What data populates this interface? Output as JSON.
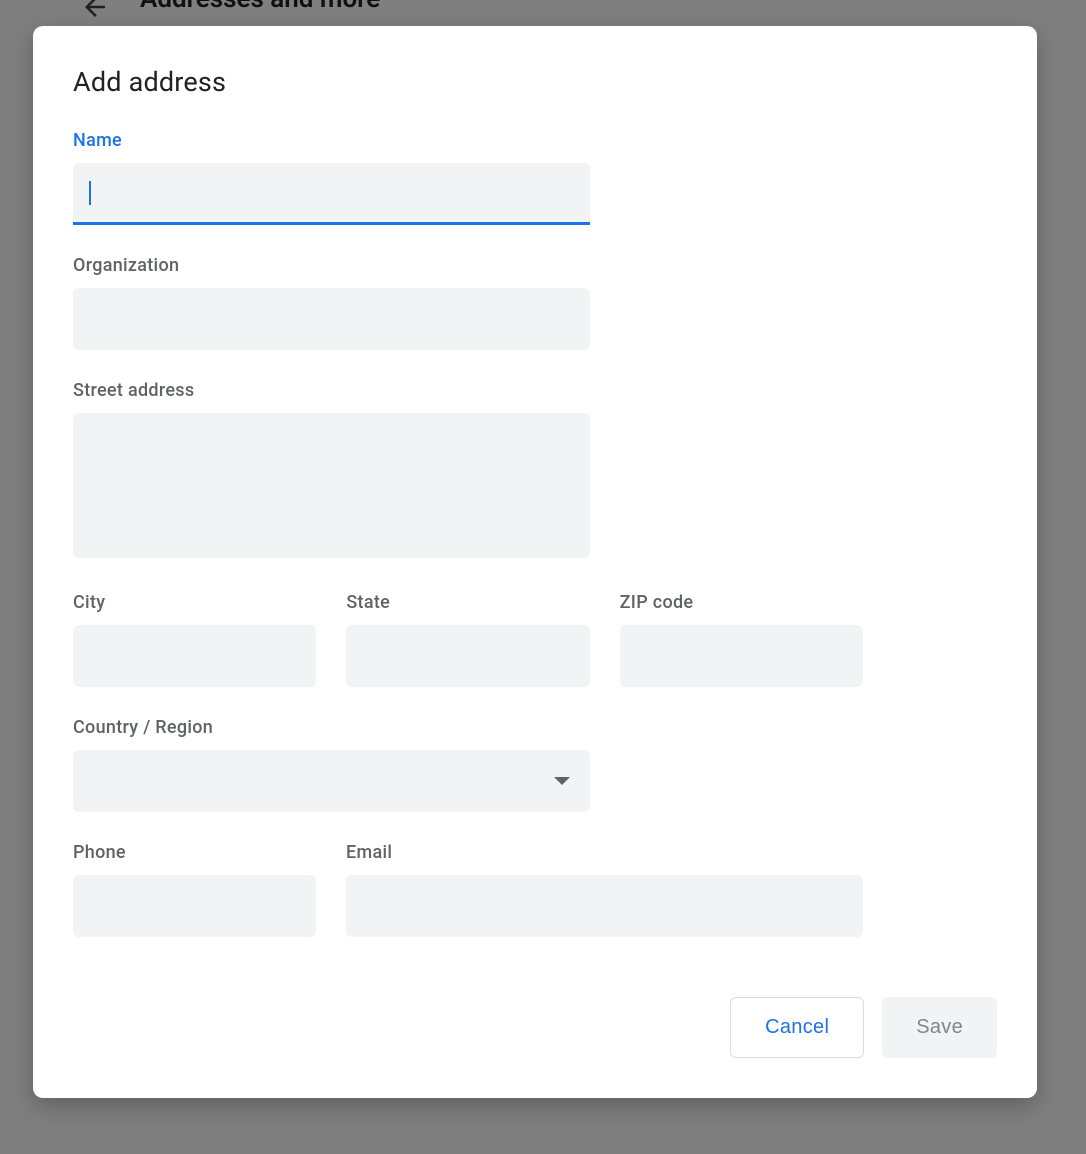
{
  "background": {
    "title": "Addresses and more",
    "side_hint": "ses"
  },
  "dialog": {
    "title": "Add address",
    "fields": {
      "name": {
        "label": "Name",
        "value": ""
      },
      "organization": {
        "label": "Organization",
        "value": ""
      },
      "street": {
        "label": "Street address",
        "value": ""
      },
      "city": {
        "label": "City",
        "value": ""
      },
      "state": {
        "label": "State",
        "value": ""
      },
      "zip": {
        "label": "ZIP code",
        "value": ""
      },
      "country": {
        "label": "Country / Region",
        "value": ""
      },
      "phone": {
        "label": "Phone",
        "value": ""
      },
      "email": {
        "label": "Email",
        "value": ""
      }
    },
    "actions": {
      "cancel": "Cancel",
      "save": "Save"
    }
  }
}
